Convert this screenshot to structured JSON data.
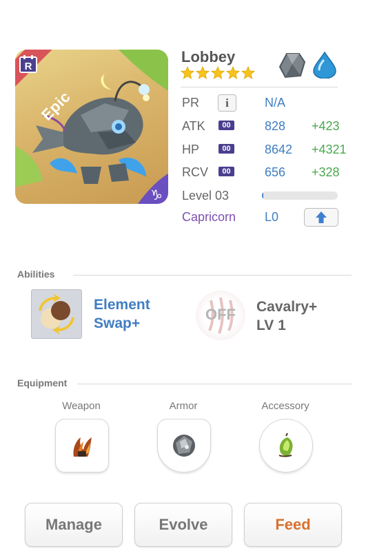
{
  "monster": {
    "name": "Lobbey",
    "rarity": "Epic",
    "stars": 5,
    "elements": [
      "earth-element-icon",
      "water-element-icon"
    ]
  },
  "stats": {
    "pr": {
      "label": "PR",
      "value": "N/A"
    },
    "atk": {
      "label": "ATK",
      "chip": "00",
      "value": "828",
      "bonus": "+423"
    },
    "hp": {
      "label": "HP",
      "chip": "00",
      "value": "8642",
      "bonus": "+4321"
    },
    "rcv": {
      "label": "RCV",
      "chip": "00",
      "value": "656",
      "bonus": "+328"
    },
    "level": {
      "label": "Level 03",
      "progress": 0.02
    },
    "constellation": {
      "label": "Capricorn",
      "level": "L0"
    }
  },
  "abilities": {
    "title": "Abilities",
    "items": [
      {
        "line1": "Element",
        "line2": "Swap+",
        "state": "on"
      },
      {
        "line1": "Cavalry+",
        "line2": "LV 1",
        "state": "OFF"
      }
    ]
  },
  "equipment": {
    "title": "Equipment",
    "slots": [
      {
        "label": "Weapon"
      },
      {
        "label": "Armor"
      },
      {
        "label": "Accessory"
      }
    ]
  },
  "actions": {
    "manage": "Manage",
    "evolve": "Evolve",
    "feed": "Feed"
  },
  "colors": {
    "value_blue": "#3f7ec2",
    "bonus_green": "#4aa84e",
    "constellation_purple": "#7f4fb0",
    "feed_orange": "#d9702e",
    "epic_red": "#d9545a",
    "frame_purple": "#6a4fc0"
  }
}
